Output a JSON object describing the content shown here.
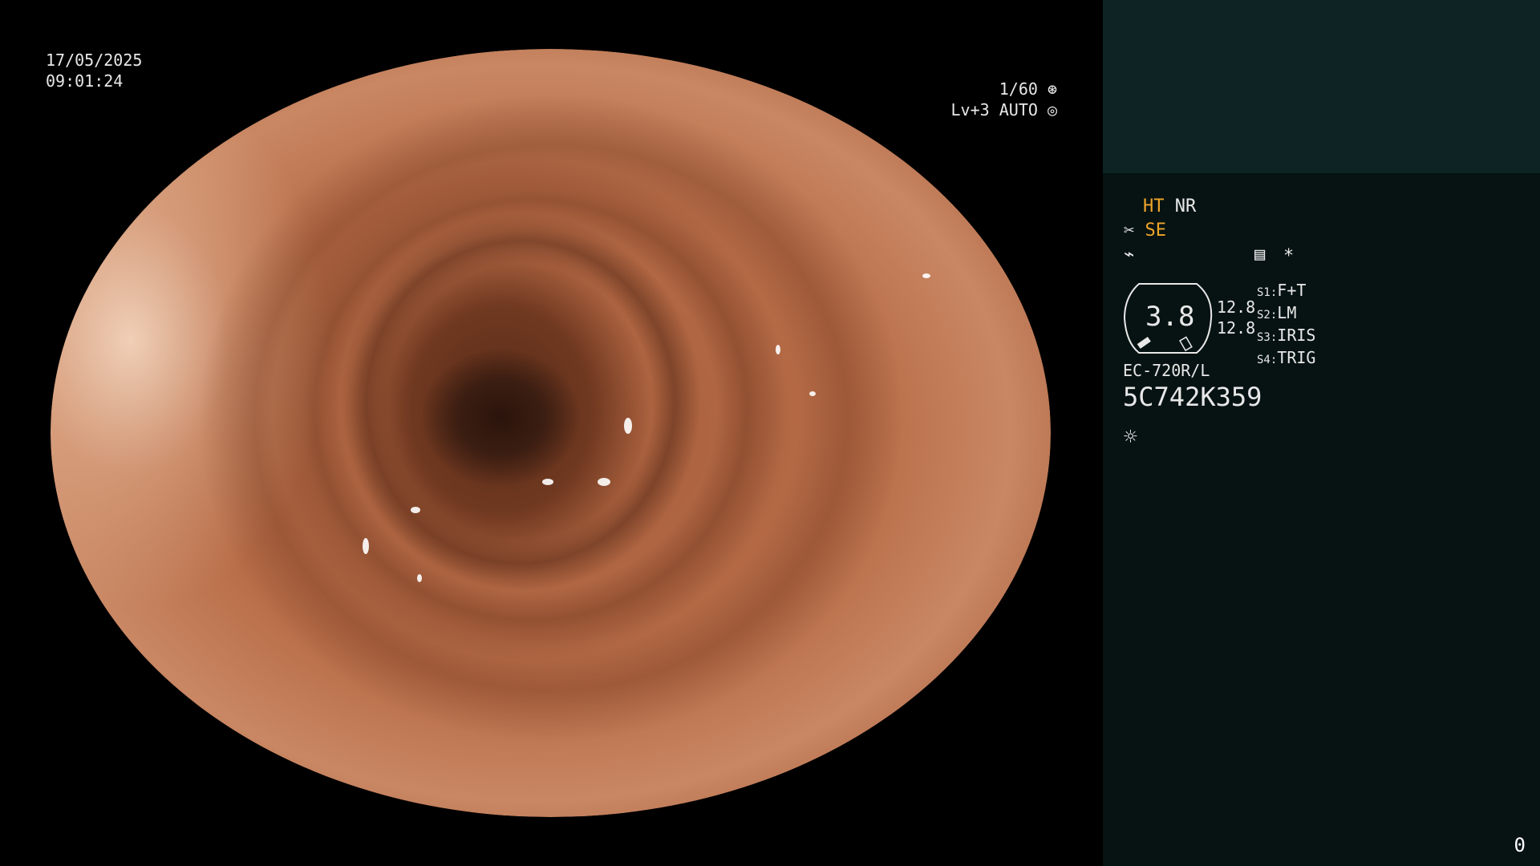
{
  "overlay": {
    "date": "17/05/2025",
    "time": "09:01:24",
    "shutter": "1/60",
    "level": "Lv+3",
    "mode": "AUTO"
  },
  "panel": {
    "ht": "HT",
    "nr": "NR",
    "se": "SE",
    "zoom_value": "3.8",
    "value1": "12.8",
    "value2": "12.8",
    "s1_label": "S1:",
    "s1_value": "F+T",
    "s2_label": "S2:",
    "s2_value": "LM",
    "s3_label": "S3:",
    "s3_value": "IRIS",
    "s4_label": "S4:",
    "s4_value": "TRIG",
    "scope_model": "EC-720R/L",
    "serial": "5C742K359",
    "frame_count": "0"
  },
  "icons": [
    "aperture-icon",
    "iris-icon",
    "scissors-icon",
    "lightning-icon",
    "settings-icon",
    "asterisk-icon",
    "light-icon"
  ],
  "colors": {
    "panel_top": "#0d2324",
    "panel": "#061312",
    "highlight": "#f0a52a"
  }
}
